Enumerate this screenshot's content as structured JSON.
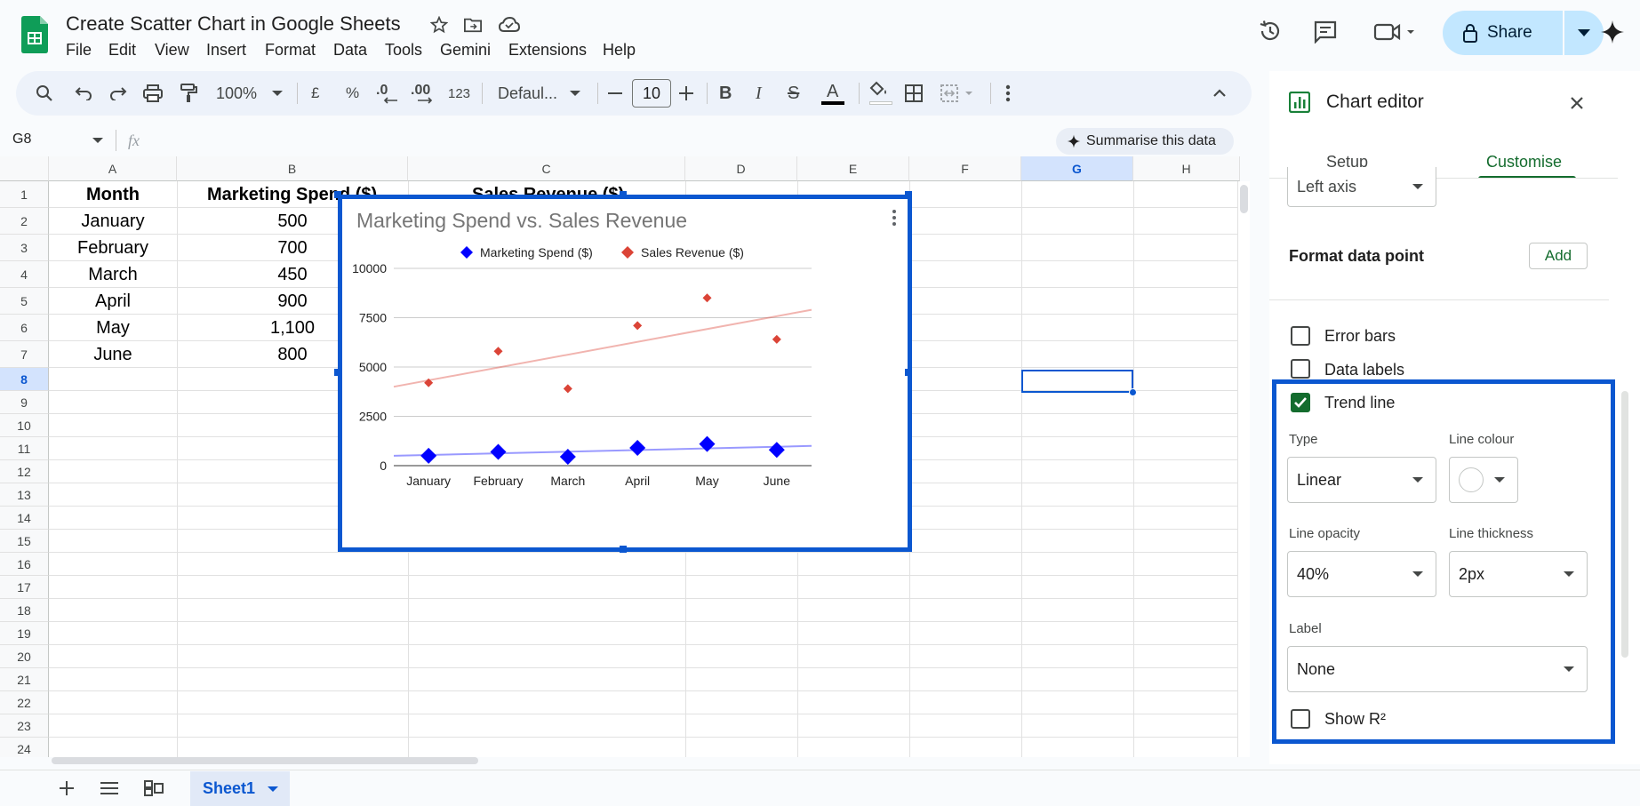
{
  "doc": {
    "title": "Create Scatter Chart in Google Sheets",
    "menu": [
      "File",
      "Edit",
      "View",
      "Insert",
      "Format",
      "Data",
      "Tools",
      "Gemini",
      "Extensions",
      "Help"
    ]
  },
  "header": {
    "share_label": "Share"
  },
  "toolbar": {
    "zoom": "100%",
    "currency": "£",
    "percent": "%",
    "dec_decrease": ".0",
    "dec_increase": ".00",
    "number_format": "123",
    "font": "Defaul...",
    "font_size": "10"
  },
  "formula_bar": {
    "cell_ref": "G8",
    "fx": "fx",
    "summarise_label": "Summarise this data"
  },
  "grid": {
    "columns": [
      "A",
      "B",
      "C",
      "D",
      "E",
      "F",
      "G",
      "H"
    ],
    "rows": [
      "1",
      "2",
      "3",
      "4",
      "5",
      "6",
      "7",
      "8",
      "9",
      "10",
      "11",
      "12",
      "13",
      "14",
      "15",
      "16",
      "17",
      "18",
      "19",
      "20",
      "21",
      "22",
      "23",
      "24"
    ],
    "header_row": [
      "Month",
      "Marketing Spend ($)",
      "Sales Revenue ($)"
    ],
    "months": [
      "January",
      "February",
      "March",
      "April",
      "May",
      "June"
    ],
    "spend": [
      "500",
      "700",
      "450",
      "900",
      "1,100",
      "800"
    ]
  },
  "chart_data": {
    "type": "scatter",
    "title": "Marketing Spend vs. Sales Revenue",
    "categories": [
      "January",
      "February",
      "March",
      "April",
      "May",
      "June"
    ],
    "series": [
      {
        "name": "Marketing Spend ($)",
        "color": "#0000ff",
        "values": [
          500,
          700,
          450,
          900,
          1100,
          800
        ],
        "trend": [
          500,
          1000
        ]
      },
      {
        "name": "Sales Revenue ($)",
        "color": "#db4437",
        "values": [
          4200,
          5800,
          3900,
          7100,
          8500,
          6400
        ],
        "trend": [
          4000,
          7900
        ]
      }
    ],
    "ylim": [
      0,
      10000
    ],
    "yticks": [
      "0",
      "2500",
      "5000",
      "7500",
      "10000"
    ],
    "legend": "top",
    "grid": true
  },
  "panel": {
    "title": "Chart editor",
    "tabs": [
      "Setup",
      "Customise"
    ],
    "axis_select": "Left axis",
    "format_point_label": "Format data point",
    "add_label": "Add",
    "error_bars": "Error bars",
    "data_labels": "Data labels",
    "trend_line": "Trend line",
    "type_label": "Type",
    "type_value": "Linear",
    "line_colour_label": "Line colour",
    "opacity_label": "Line opacity",
    "opacity_value": "40%",
    "thickness_label": "Line thickness",
    "thickness_value": "2px",
    "label_label": "Label",
    "label_value": "None",
    "show_r2": "Show R²"
  },
  "sheets": {
    "active": "Sheet1"
  },
  "colors": {
    "accent": "#0b57d0",
    "share_bg": "#c2e7ff",
    "check": "#146c2e",
    "sheets_green": "#0f9d58"
  }
}
